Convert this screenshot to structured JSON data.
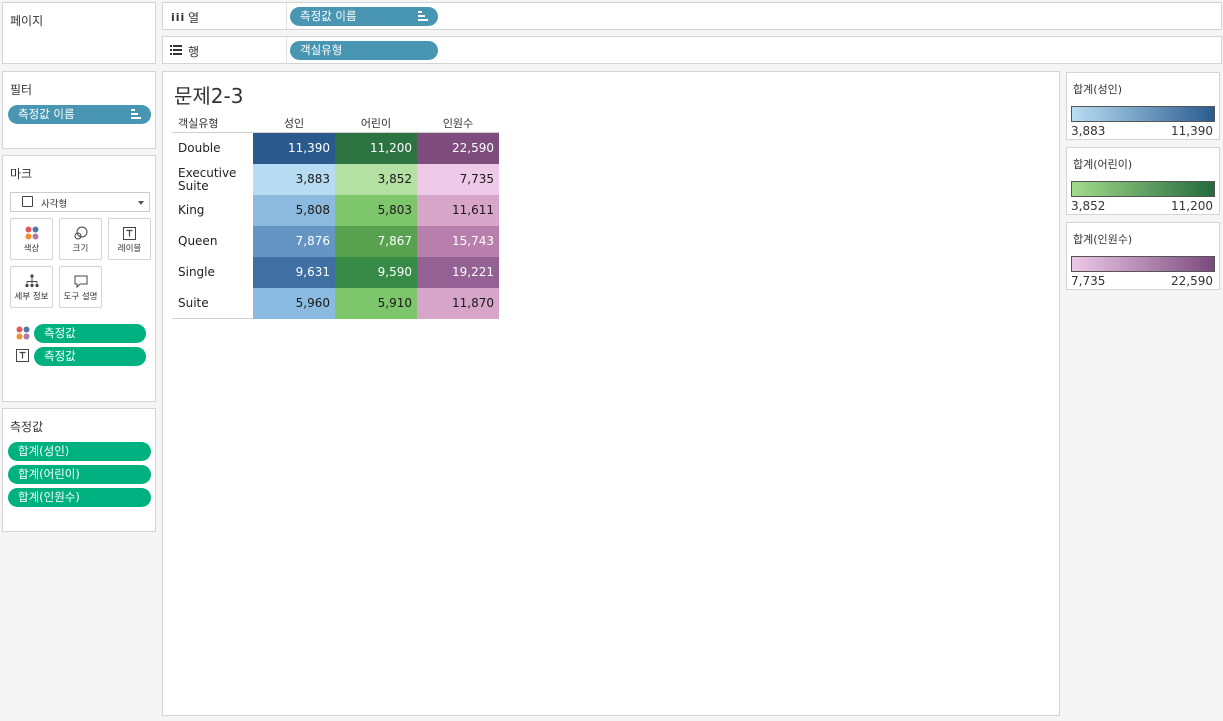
{
  "pages": {
    "title": "페이지"
  },
  "shelves": {
    "columns": {
      "label": "열",
      "pill": "측정값 이름"
    },
    "rows": {
      "label": "행",
      "pill": "객실유형"
    }
  },
  "filters": {
    "title": "필터",
    "pill": "측정값 이름"
  },
  "marks": {
    "title": "마크",
    "mark_type": "사각형",
    "buttons": {
      "color": "색상",
      "size": "크기",
      "label": "레이블",
      "detail": "세부 정보",
      "tooltip": "도구 설명"
    },
    "fields": [
      "측정값",
      "측정값"
    ]
  },
  "measure_values": {
    "title": "측정값",
    "items": [
      "합계(성인)",
      "합계(어린이)",
      "합계(인원수)"
    ]
  },
  "sheet": {
    "title": "문제2-3",
    "row_header": "객실유형",
    "col_headers": [
      "성인",
      "어린이",
      "인원수"
    ],
    "rows": [
      {
        "label": "Double",
        "values": [
          "11,390",
          "11,200",
          "22,590"
        ]
      },
      {
        "label": "Executive Suite",
        "values": [
          "3,883",
          "3,852",
          "7,735"
        ]
      },
      {
        "label": "King",
        "values": [
          "5,808",
          "5,803",
          "11,611"
        ]
      },
      {
        "label": "Queen",
        "values": [
          "7,876",
          "7,867",
          "15,743"
        ]
      },
      {
        "label": "Single",
        "values": [
          "9,631",
          "9,590",
          "19,221"
        ]
      },
      {
        "label": "Suite",
        "values": [
          "5,960",
          "5,910",
          "11,870"
        ]
      }
    ],
    "cell_colors": [
      [
        "#2a5a8d",
        "#2c7341",
        "#7f4c7e"
      ],
      [
        "#b7dcf2",
        "#b4e0a4",
        "#efc9e8"
      ],
      [
        "#8cbade",
        "#7ec66c",
        "#d7a6c9"
      ],
      [
        "#6495c3",
        "#58a24f",
        "#b87fac"
      ],
      [
        "#3f6fa3",
        "#388a47",
        "#936194"
      ],
      [
        "#8abadf",
        "#7dc66b",
        "#d6a5c9"
      ]
    ]
  },
  "legends": [
    {
      "title": "합계(성인)",
      "min": "3,883",
      "max": "11,390",
      "from": "#b9def3",
      "to": "#2b5b8e"
    },
    {
      "title": "합계(어린이)",
      "min": "3,852",
      "max": "11,200",
      "from": "#a3db8c",
      "to": "#246a3c"
    },
    {
      "title": "합계(인원수)",
      "min": "7,735",
      "max": "22,590",
      "from": "#eec8e8",
      "to": "#7b4a7e"
    }
  ]
}
